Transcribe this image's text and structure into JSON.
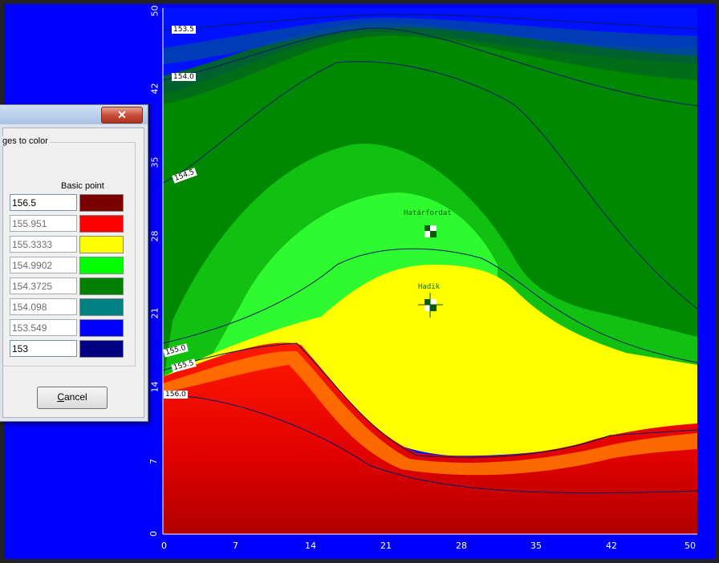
{
  "dialog": {
    "close_glyph": "✕",
    "group_label": "ges to color",
    "column_header": "Basic point",
    "rows": [
      {
        "value": "156.5",
        "color": "#7a0000",
        "editable": true
      },
      {
        "value": "155.951",
        "color": "#ff0000",
        "editable": false
      },
      {
        "value": "155.3333",
        "color": "#ffff00",
        "editable": false
      },
      {
        "value": "154.9902",
        "color": "#00ff00",
        "editable": false
      },
      {
        "value": "154.3725",
        "color": "#008000",
        "editable": false
      },
      {
        "value": "154.098",
        "color": "#008080",
        "editable": false
      },
      {
        "value": "153.549",
        "color": "#0000ff",
        "editable": false
      },
      {
        "value": "153",
        "color": "#000080",
        "editable": true
      }
    ],
    "cancel_label": "Cancel",
    "cancel_mnemonic": "C",
    "cancel_rest": "ancel"
  },
  "map": {
    "x_ticks": [
      "0",
      "7",
      "14",
      "21",
      "28",
      "35",
      "42",
      "50"
    ],
    "y_ticks": [
      "50",
      "42",
      "35",
      "28",
      "21",
      "14",
      "7",
      "0"
    ],
    "contour_labels": [
      "153.5",
      "154.0",
      "154.5",
      "155.0",
      "155.5",
      "156.0"
    ],
    "points": [
      {
        "label": "Határfordat"
      },
      {
        "label": "Hadik"
      }
    ]
  }
}
